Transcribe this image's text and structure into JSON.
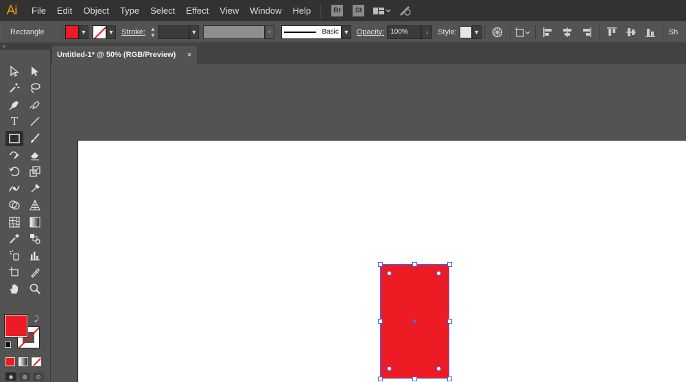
{
  "app": {
    "logo": "Ai"
  },
  "menu": [
    "File",
    "Edit",
    "Object",
    "Type",
    "Select",
    "Effect",
    "View",
    "Window",
    "Help"
  ],
  "menubar_buttons": {
    "bridge": "Br",
    "stock": "St"
  },
  "control": {
    "tool_name": "Rectangle",
    "stroke_label": "Stroke:",
    "profile_label": "Basic",
    "opacity_label": "Opacity:",
    "opacity_value": "100%",
    "style_label": "Style:",
    "trailing": "Sh"
  },
  "toolbar_icons": [
    "selection-icon",
    "direct-selection-icon",
    "magic-wand-icon",
    "lasso-icon",
    "pen-icon",
    "curvature-icon",
    "type-icon",
    "line-segment-icon",
    "rectangle-icon",
    "paintbrush-icon",
    "shaper-icon",
    "eraser-icon",
    "rotate-icon",
    "scale-icon",
    "width-icon",
    "puppet-warp-icon",
    "shape-builder-icon",
    "perspective-grid-icon",
    "mesh-icon",
    "gradient-icon",
    "eyedropper-icon",
    "blend-icon",
    "symbol-sprayer-icon",
    "column-graph-icon",
    "artboard-icon",
    "slice-icon",
    "hand-icon",
    "zoom-icon"
  ],
  "document": {
    "tab_title": "Untitled-1* @ 50% (RGB/Preview)",
    "close": "×"
  },
  "colors": {
    "fill": "#ed1c24",
    "selection": "#4a66e8",
    "artboard": "#ffffff"
  }
}
